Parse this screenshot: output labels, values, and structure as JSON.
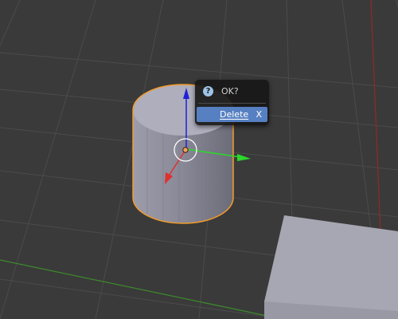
{
  "dialog": {
    "question_icon": "question-icon",
    "title": "OK?",
    "item_label": "Delete",
    "item_shortcut": "X"
  },
  "scene": {
    "objects": [
      "cylinder-mesh",
      "cube-mesh"
    ],
    "selected": "cylinder-mesh",
    "gizmo_axes": [
      "x-axis",
      "y-axis",
      "z-axis"
    ],
    "colors": {
      "background": "#3a3a3a",
      "grid": "#4c4c4c",
      "x_axis_line": "#8b2a2a",
      "y_axis_line": "#3c8a2c",
      "selection_outline": "#f39b2a",
      "gizmo_x": "#e03030",
      "gizmo_y": "#2bd82b",
      "gizmo_z": "#2020d8",
      "menu_highlight": "#5680c2"
    }
  }
}
